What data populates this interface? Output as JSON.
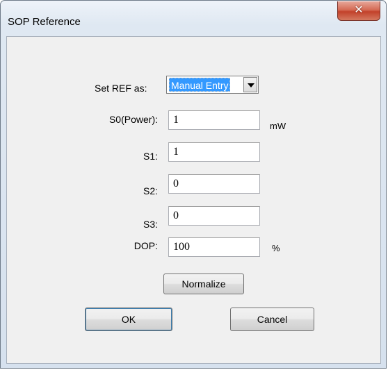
{
  "window": {
    "title": "SOP Reference",
    "close_glyph": "✕"
  },
  "form": {
    "set_ref_label": "Set REF as:",
    "set_ref_value": "Manual Entry",
    "s0_label": "S0(Power):",
    "s0_value": "1",
    "s0_unit": "mW",
    "s1_label": "S1:",
    "s1_value": "1",
    "s2_label": "S2:",
    "s2_value": "0",
    "s3_label": "S3:",
    "s3_value": "0",
    "dop_label": "DOP:",
    "dop_value": "100",
    "dop_unit": "%"
  },
  "buttons": {
    "normalize": "Normalize",
    "ok": "OK",
    "cancel": "Cancel"
  },
  "colors": {
    "selection": "#3399ff",
    "close_button": "#c2412a"
  },
  "icons": {
    "close": "close-icon",
    "dropdown": "chevron-down-icon"
  }
}
